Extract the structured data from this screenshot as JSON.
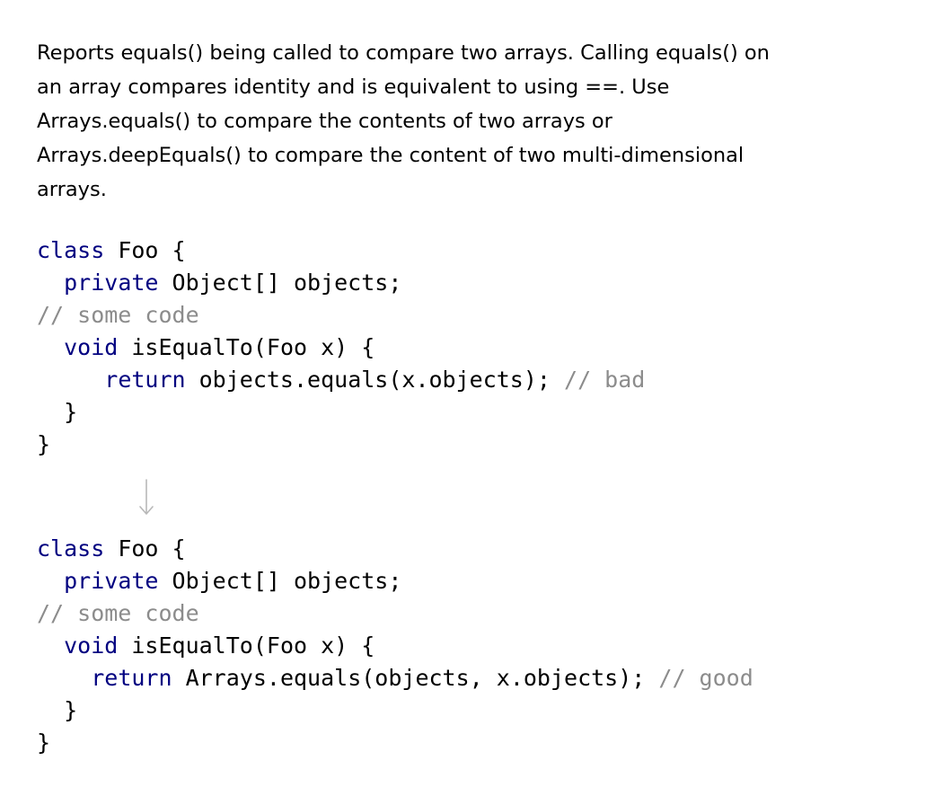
{
  "description": {
    "lines": [
      "Reports equals() being called to compare two arrays. Calling equals() on",
      "an array compares identity and is equivalent to using ==. Use",
      "Arrays.equals() to compare the contents of two arrays or",
      "Arrays.deepEquals() to compare the content of two multi-dimensional",
      "arrays."
    ]
  },
  "before": {
    "line1": {
      "kw": "class",
      "rest": " Foo {"
    },
    "line2": {
      "indent": "  ",
      "kw": "private",
      "rest": " Object[] objects;"
    },
    "line3": {
      "comment": "// some code"
    },
    "line4": {
      "indent": "  ",
      "kw": "void",
      "rest": " isEqualTo(Foo x) {"
    },
    "line5": {
      "indent": "     ",
      "kw": "return",
      "rest": " objects.equals(x.objects); ",
      "comment": "// bad"
    },
    "line6": {
      "text": "  }"
    },
    "line7": {
      "text": "}"
    }
  },
  "after": {
    "line1": {
      "kw": "class",
      "rest": " Foo {"
    },
    "line2": {
      "indent": "  ",
      "kw": "private",
      "rest": " Object[] objects;"
    },
    "line3": {
      "comment": "// some code"
    },
    "line4": {
      "indent": "  ",
      "kw": "void",
      "rest": " isEqualTo(Foo x) {"
    },
    "line5": {
      "indent": "    ",
      "kw": "return",
      "rest": " Arrays.equals(objects, x.objects); ",
      "comment": "// good"
    },
    "line6": {
      "text": "  }"
    },
    "line7": {
      "text": "}"
    }
  },
  "arrow": {
    "icon": "arrow-down-icon",
    "color": "#b8b8b8"
  },
  "colors": {
    "keyword": "#000080",
    "comment": "#8c8c8c",
    "text": "#000000",
    "background": "#ffffff"
  }
}
